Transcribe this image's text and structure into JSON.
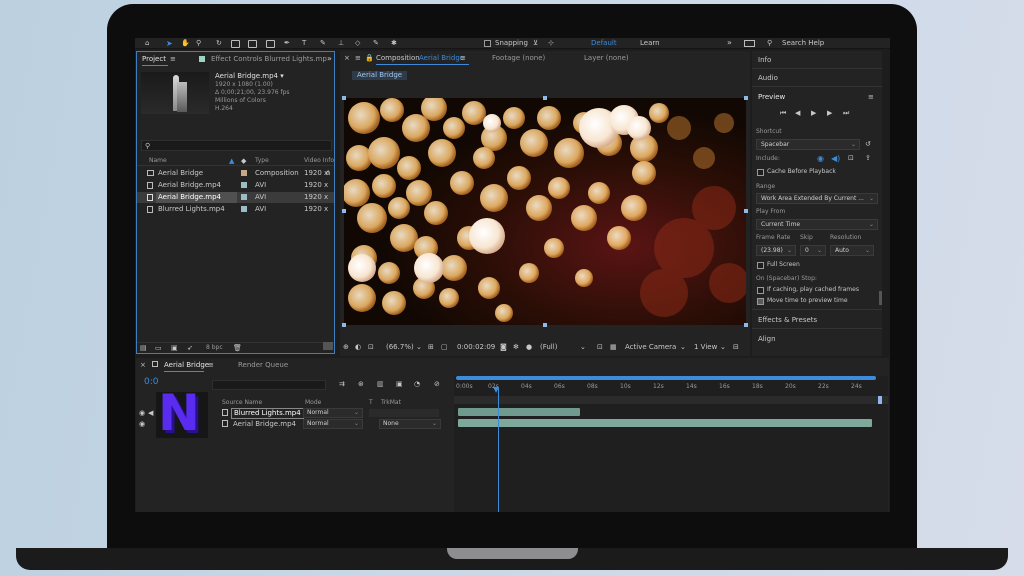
{
  "toolbar": {
    "snapping": "Snapping",
    "workspace_default": "Default",
    "workspace_learn": "Learn",
    "more": "»",
    "search_help": "Search Help"
  },
  "project_panel": {
    "tab_project": "Project",
    "tab_effect_controls": "Effect Controls Blurred Lights.mp",
    "selected_item": {
      "name": "Aerial Bridge.mp4 ▾",
      "resolution": "1920 x 1080 (1.00)",
      "duration": "Δ 0;00;21;00, 23.976 fps",
      "colors": "Millions of Colors",
      "codec": "H.264"
    },
    "search_placeholder": "",
    "columns": {
      "name": "Name",
      "type": "Type",
      "video_info": "Video Info"
    },
    "items": [
      {
        "name": "Aerial Bridge",
        "type": "Composition",
        "info": "1920 x"
      },
      {
        "name": "Aerial Bridge.mp4",
        "type": "AVI",
        "info": "1920 x"
      },
      {
        "name": "Aerial Bridge.mp4",
        "type": "AVI",
        "info": "1920 x"
      },
      {
        "name": "Blurred Lights.mp4",
        "type": "AVI",
        "info": "1920 x"
      }
    ],
    "bpc": "8 bpc"
  },
  "composition_panel": {
    "tab_label_prefix": "Composition",
    "tab_comp_name": "Aerial Bridge",
    "tab_footage": "Footage (none)",
    "tab_layer": "Layer (none)",
    "breadcrumb": "Aerial Bridge",
    "zoom": "(66.7%)",
    "timecode": "0:00:02:09",
    "resolution": "(Full)",
    "camera": "Active Camera",
    "views": "1 View"
  },
  "right_panel": {
    "info": "Info",
    "audio": "Audio",
    "preview": "Preview",
    "shortcut_label": "Shortcut",
    "shortcut_value": "Spacebar",
    "include_label": "Include:",
    "cache_before_playback": "Cache Before Playback",
    "range_label": "Range",
    "range_value": "Work Area Extended By Current ...",
    "play_from_label": "Play From",
    "play_from_value": "Current Time",
    "frame_rate_label": "Frame Rate",
    "skip_label": "Skip",
    "resolution_label": "Resolution",
    "frame_rate_value": "(23.98)",
    "skip_value": "0",
    "resolution_value": "Auto",
    "full_screen": "Full Screen",
    "on_stop_label": "On (Spacebar) Stop:",
    "if_caching": "If caching, play cached frames",
    "move_time": "Move time to preview time",
    "effects_presets": "Effects & Presets",
    "align": "Align"
  },
  "timeline": {
    "tab_comp": "Aerial Bridge",
    "tab_render_queue": "Render Queue",
    "timecode": "0:0",
    "columns": {
      "source_name": "Source Name",
      "mode": "Mode",
      "t": "T",
      "trkmat": "TrkMat"
    },
    "layers": [
      {
        "num": "1",
        "name": "Blurred Lights.mp4",
        "mode": "Normal",
        "trkmat": ""
      },
      {
        "num": "2",
        "name": "Aerial Bridge.mp4",
        "mode": "Normal",
        "trkmat": "None"
      }
    ],
    "ruler": [
      "0:00s",
      "02s",
      "04s",
      "06s",
      "08s",
      "10s",
      "12s",
      "14s",
      "16s",
      "18s",
      "20s",
      "22s",
      "24s"
    ]
  },
  "watermark_letter": "N",
  "colors": {
    "accent_blue": "#3d8bd9",
    "layer_bar": "#7fa89c",
    "background": "#1d1d1d"
  }
}
